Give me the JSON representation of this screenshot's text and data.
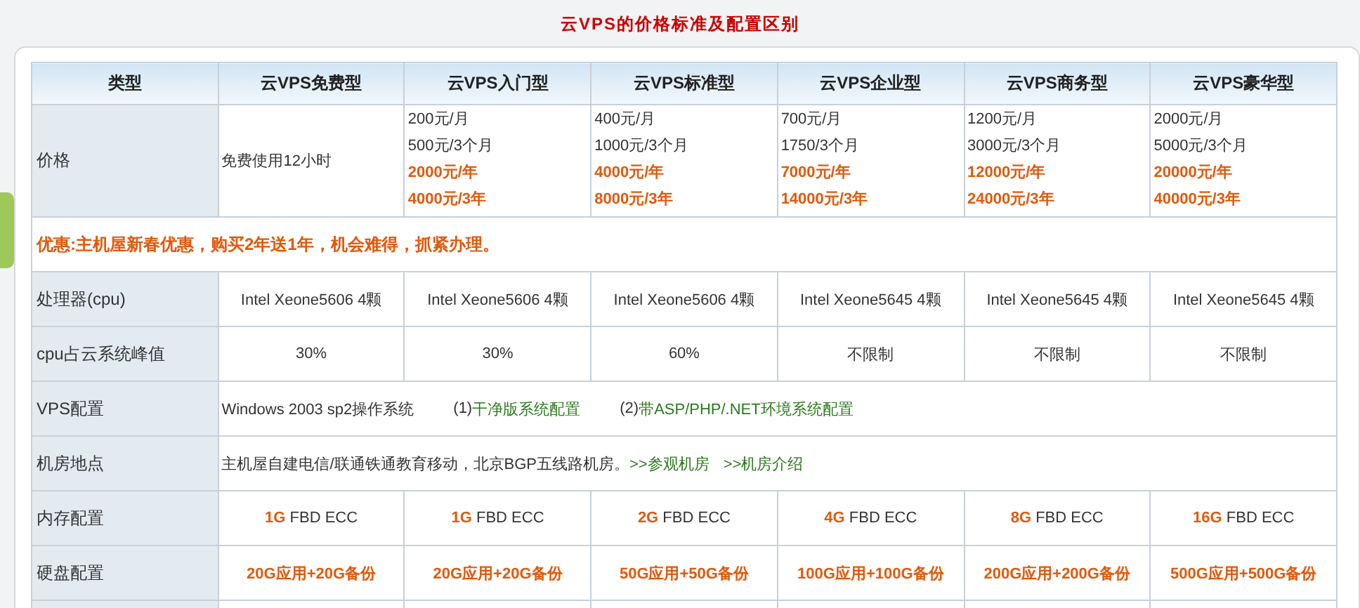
{
  "title": "云VPS的价格标准及配置区别",
  "table": {
    "columns": [
      "类型",
      "云VPS免费型",
      "云VPS入门型",
      "云VPS标准型",
      "云VPS企业型",
      "云VPS商务型",
      "云VPS豪华型"
    ],
    "price_row": {
      "label": "价格",
      "cells": [
        {
          "lines": [
            {
              "text": "免费使用12小时",
              "emphasis": false
            }
          ]
        },
        {
          "lines": [
            {
              "text": "200元/月",
              "emphasis": false
            },
            {
              "text": "500元/3个月",
              "emphasis": false
            },
            {
              "text": "2000元/年",
              "emphasis": true
            },
            {
              "text": "4000元/3年",
              "emphasis": true
            }
          ]
        },
        {
          "lines": [
            {
              "text": "400元/月",
              "emphasis": false
            },
            {
              "text": "1000元/3个月",
              "emphasis": false
            },
            {
              "text": "4000元/年",
              "emphasis": true
            },
            {
              "text": "8000元/3年",
              "emphasis": true
            }
          ]
        },
        {
          "lines": [
            {
              "text": "700元/月",
              "emphasis": false
            },
            {
              "text": "1750/3个月",
              "emphasis": false
            },
            {
              "text": "7000元/年",
              "emphasis": true
            },
            {
              "text": "14000元/3年",
              "emphasis": true
            }
          ]
        },
        {
          "lines": [
            {
              "text": "1200元/月",
              "emphasis": false
            },
            {
              "text": "3000元/3个月",
              "emphasis": false
            },
            {
              "text": "12000元/年",
              "emphasis": true
            },
            {
              "text": "24000元/3年",
              "emphasis": true
            }
          ]
        },
        {
          "lines": [
            {
              "text": "2000元/月",
              "emphasis": false
            },
            {
              "text": "5000元/3个月",
              "emphasis": false
            },
            {
              "text": "20000元/年",
              "emphasis": true
            },
            {
              "text": "40000元/3年",
              "emphasis": true
            }
          ]
        }
      ]
    },
    "promo": "优惠:主机屋新春优惠，购买2年送1年，机会难得，抓紧办理。",
    "rows": [
      {
        "kind": "cells",
        "label": "处理器(cpu)",
        "cells": [
          {
            "text": "Intel Xeone5606 4颗",
            "emphasis": false
          },
          {
            "text": "Intel Xeone5606 4颗",
            "emphasis": false
          },
          {
            "text": "Intel Xeone5606 4颗",
            "emphasis": false
          },
          {
            "text": "Intel Xeone5645 4颗",
            "emphasis": false
          },
          {
            "text": "Intel Xeone5645 4颗",
            "emphasis": false
          },
          {
            "text": "Intel Xeone5645 4颗",
            "emphasis": false
          }
        ]
      },
      {
        "kind": "cells",
        "label": "cpu占云系统峰值",
        "cells": [
          {
            "text": "30%",
            "emphasis": false
          },
          {
            "text": "30%",
            "emphasis": false
          },
          {
            "text": "60%",
            "emphasis": false
          },
          {
            "text": "不限制",
            "emphasis": false
          },
          {
            "text": "不限制",
            "emphasis": false
          },
          {
            "text": "不限制",
            "emphasis": false
          }
        ]
      },
      {
        "kind": "span",
        "label": "VPS配置",
        "items": [
          {
            "kind": "text",
            "text": "Windows 2003 sp2操作系统"
          },
          {
            "kind": "text",
            "text": "(1)"
          },
          {
            "kind": "link",
            "text": "干净版系统配置"
          },
          {
            "kind": "text",
            "text": "(2)"
          },
          {
            "kind": "link",
            "text": "带ASP/PHP/.NET环境系统配置"
          }
        ]
      },
      {
        "kind": "span",
        "label": "机房地点",
        "items": [
          {
            "kind": "text",
            "text": "主机屋自建电信/联通铁通教育移动，北京BGP五线路机房。"
          },
          {
            "kind": "link",
            "text": ">>参观机房"
          },
          {
            "kind": "link",
            "text": ">>机房介绍"
          }
        ]
      },
      {
        "kind": "cells",
        "label": "内存配置",
        "cells": [
          {
            "text": "**1G** FBD ECC",
            "emphasis": false
          },
          {
            "text": "**1G** FBD ECC",
            "emphasis": false
          },
          {
            "text": "**2G** FBD ECC",
            "emphasis": false
          },
          {
            "text": "**4G** FBD ECC",
            "emphasis": false
          },
          {
            "text": "**8G** FBD ECC",
            "emphasis": false
          },
          {
            "text": "**16G** FBD ECC",
            "emphasis": false
          }
        ]
      },
      {
        "kind": "cells",
        "label": "硬盘配置",
        "cells": [
          {
            "text": "20G应用+20G备份",
            "emphasis": true
          },
          {
            "text": "20G应用+20G备份",
            "emphasis": true
          },
          {
            "text": "50G应用+50G备份",
            "emphasis": true
          },
          {
            "text": "100G应用+100G备份",
            "emphasis": true
          },
          {
            "text": "200G应用+200G备份",
            "emphasis": true
          },
          {
            "text": "500G应用+500G备份",
            "emphasis": true
          }
        ]
      }
    ]
  }
}
